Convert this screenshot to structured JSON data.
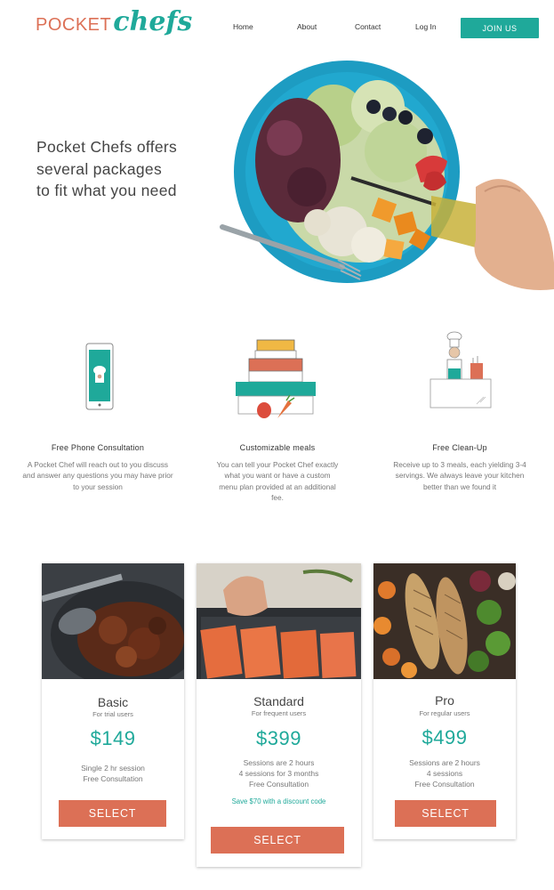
{
  "brand": {
    "part1": "POCKET",
    "part2": "chefs"
  },
  "nav": {
    "home": "Home",
    "about": "About",
    "contact": "Contact",
    "login": "Log In",
    "join": "JOIN US"
  },
  "hero": {
    "line1": "Pocket Chefs offers",
    "line2": "several packages",
    "line3": "to fit what you need"
  },
  "features": [
    {
      "title": "Free Phone Consultation",
      "description": "A Pocket Chef will reach out to you discuss and answer any questions you may have prior to your session",
      "icon": "phone-chef-icon"
    },
    {
      "title": "Customizable meals",
      "description": "You can tell your Pocket Chef exactly what you want or have a custom menu plan provided at an additional fee.",
      "icon": "meal-boxes-icon"
    },
    {
      "title": "Free Clean-Up",
      "description": "Receive up to 3 meals, each yielding 3-4 servings. We always leave your kitchen better than we found it",
      "icon": "kitchen-counter-icon"
    }
  ],
  "plans": [
    {
      "name": "Basic",
      "audience": "For trial users",
      "price": "$149",
      "details": [
        "Single 2 hr session",
        "Free Consultation"
      ],
      "cta": "SELECT"
    },
    {
      "name": "Standard",
      "audience": "For frequent users",
      "price": "$399",
      "details": [
        "Sessions are 2 hours",
        "4 sessions for 3 months",
        "Free Consultation"
      ],
      "discount": "Save $70 with a discount code",
      "cta": "SELECT"
    },
    {
      "name": "Pro",
      "audience": "For regular users",
      "price": "$499",
      "details": [
        "Sessions are 2 hours",
        "4 sessions",
        "Free Consultation"
      ],
      "cta": "SELECT"
    }
  ],
  "colors": {
    "teal": "#1fa99a",
    "coral": "#dc7056"
  }
}
